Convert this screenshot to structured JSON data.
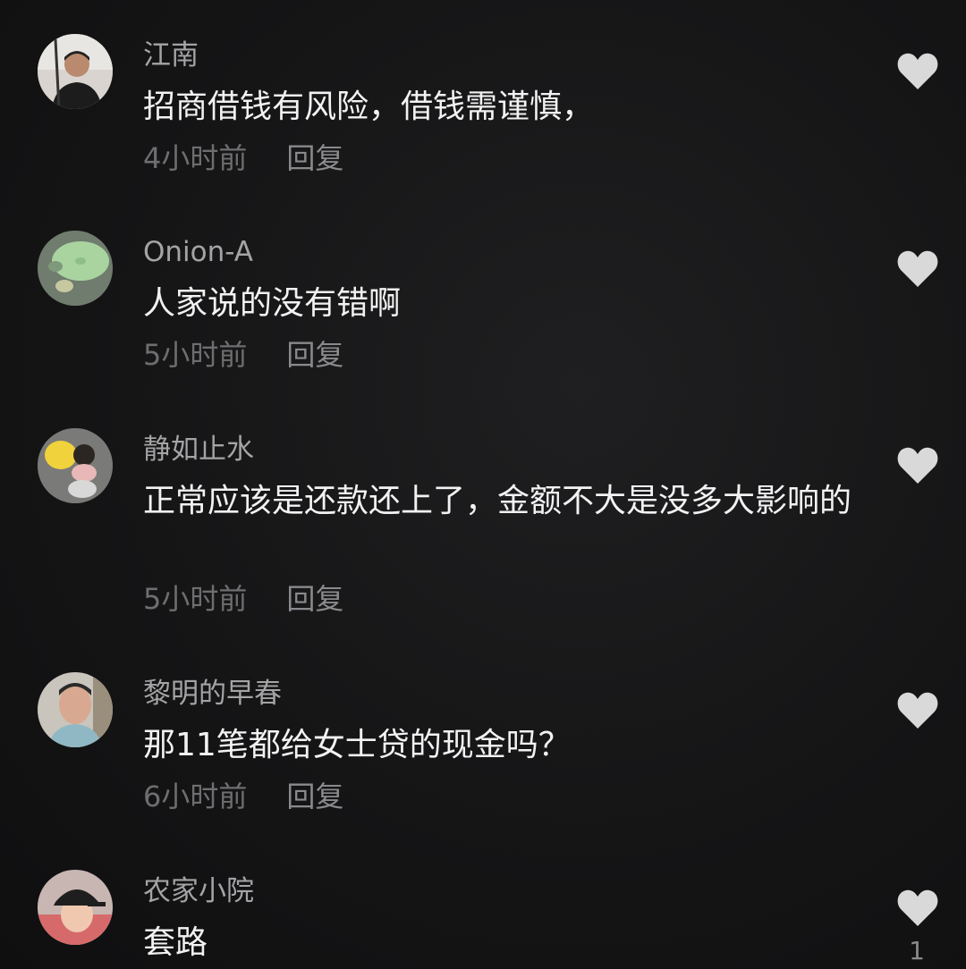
{
  "comments": [
    {
      "username": "江南",
      "text": "招商借钱有风险，借钱需谨慎，",
      "time": "4小时前",
      "reply_label": "回复",
      "avatar": "man-with-fishing-rod-avatar"
    },
    {
      "username": "Onion-A",
      "text": "人家说的没有错啊",
      "time": "5小时前",
      "reply_label": "回复",
      "avatar": "lotus-leaf-avatar"
    },
    {
      "username": "静如止水",
      "text": "正常应该是还款还上了，金额不大是没多大影响的",
      "time": "5小时前",
      "reply_label": "回复",
      "avatar": "child-with-yellow-toy-avatar"
    },
    {
      "username": "黎明的早春",
      "text": "那11笔都给女士贷的现金吗？",
      "time": "6小时前",
      "reply_label": "回复",
      "avatar": "man-portrait-avatar"
    },
    {
      "username": "农家小院",
      "text": "套路",
      "like_count": "1",
      "avatar": "child-in-cap-avatar"
    }
  ],
  "icons": {
    "like": "heart-icon"
  },
  "colors": {
    "username": "#a4a4a6",
    "text": "#f2f2f2",
    "meta": "#6e6e71",
    "heart": "#d9d9d9"
  }
}
